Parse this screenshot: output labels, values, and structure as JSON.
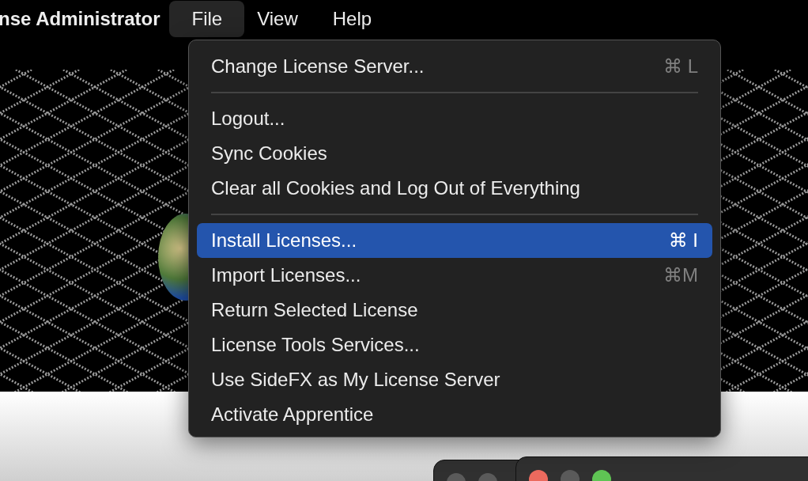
{
  "menu_bar": {
    "app_title": "nse Administrator",
    "menus": [
      {
        "label": "File",
        "selected": true
      },
      {
        "label": "View",
        "selected": false
      },
      {
        "label": "Help",
        "selected": false
      }
    ]
  },
  "file_menu": {
    "items": [
      {
        "kind": "item",
        "label": "Change License Server...",
        "shortcut": "⌘ L",
        "selected": false
      },
      {
        "kind": "separator"
      },
      {
        "kind": "item",
        "label": "Logout...",
        "selected": false
      },
      {
        "kind": "item",
        "label": "Sync Cookies",
        "selected": false
      },
      {
        "kind": "item",
        "label": "Clear all Cookies and Log Out of Everything",
        "selected": false
      },
      {
        "kind": "separator"
      },
      {
        "kind": "item",
        "label": "Install Licenses...",
        "shortcut": "⌘ I",
        "selected": true
      },
      {
        "kind": "item",
        "label": "Import Licenses...",
        "shortcut": "⌘M",
        "selected": false
      },
      {
        "kind": "item",
        "label": "Return Selected License",
        "selected": false
      },
      {
        "kind": "item",
        "label": "License Tools Services...",
        "selected": false
      },
      {
        "kind": "item",
        "label": "Use SideFX as My License Server",
        "selected": false
      },
      {
        "kind": "item",
        "label": "Activate Apprentice",
        "selected": false
      }
    ]
  }
}
